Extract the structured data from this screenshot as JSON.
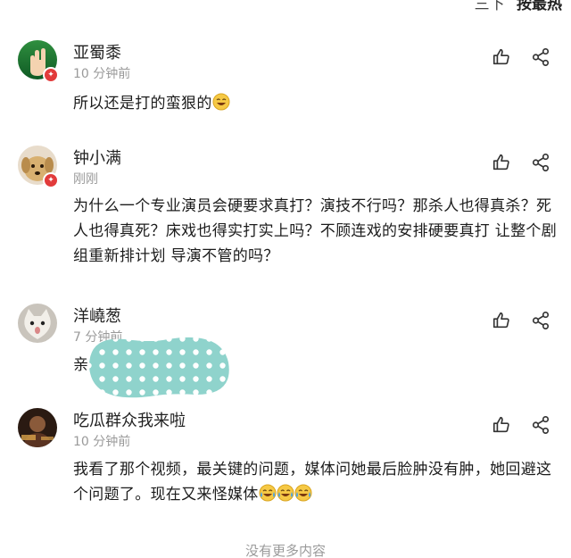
{
  "sort": {
    "option_a": "三下",
    "option_b": "按最热"
  },
  "comments": [
    {
      "username": "亚蜀黍",
      "time": "10 分钟前",
      "text": "所以还是打的蛮狠的",
      "emoji_count": 1,
      "avatar": "hand-rock-icon",
      "badge": true
    },
    {
      "username": "钟小满",
      "time": "刚刚",
      "text": "为什么一个专业演员会硬要求真打？演技不行吗？那杀人也得真杀？死人也得真死？床戏也得实打实上吗？不顾连戏的安排硬要真打 让整个剧组重新排计划 导演不管的吗？",
      "emoji_count": 0,
      "avatar": "dog-icon",
      "badge": true
    },
    {
      "username": "洋嶢葱",
      "time": "7 分钟前",
      "text": "亲",
      "emoji_count": 0,
      "avatar": "cat-icon",
      "badge": false
    },
    {
      "username": "吃瓜群众我来啦",
      "time": "10 分钟前",
      "text": "我看了那个视频，最关键的问题，媒体问她最后脸肿没有肿，她回避这个问题了。现在又来怪媒体",
      "emoji_count": 3,
      "avatar": "person-photo-icon",
      "badge": false
    }
  ],
  "footer": {
    "text": "没有更多内容"
  },
  "colors": {
    "badge": "#e23b3b",
    "mosaic": "#8fd3cc",
    "time": "#9a9a9a"
  }
}
